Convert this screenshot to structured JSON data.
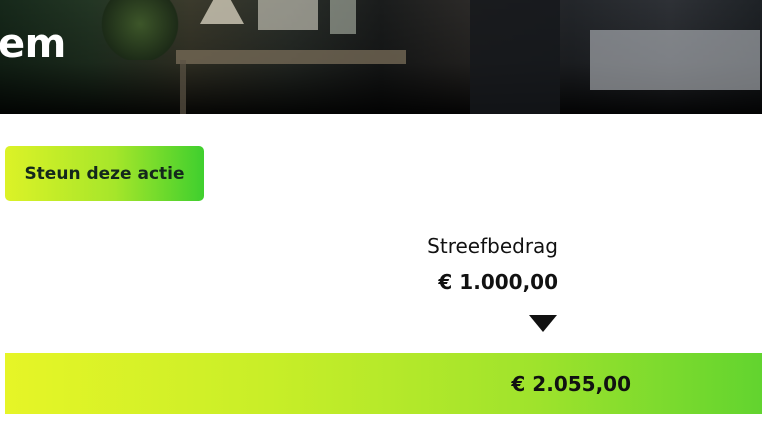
{
  "hero": {
    "title_fragment": "em"
  },
  "campaign": {
    "support_button_label": "Steun deze actie",
    "target_label": "Streefbedrag",
    "target_amount": "€ 1.000,00",
    "raised_amount": "€ 2.055,00",
    "progress_fraction": 2.055
  },
  "colors": {
    "accent_gradient_start": "#e6f527",
    "accent_gradient_end": "#62d42f",
    "text": "#111111",
    "marker": "#111111"
  },
  "icons": {
    "target_marker": "triangle-down-icon"
  }
}
